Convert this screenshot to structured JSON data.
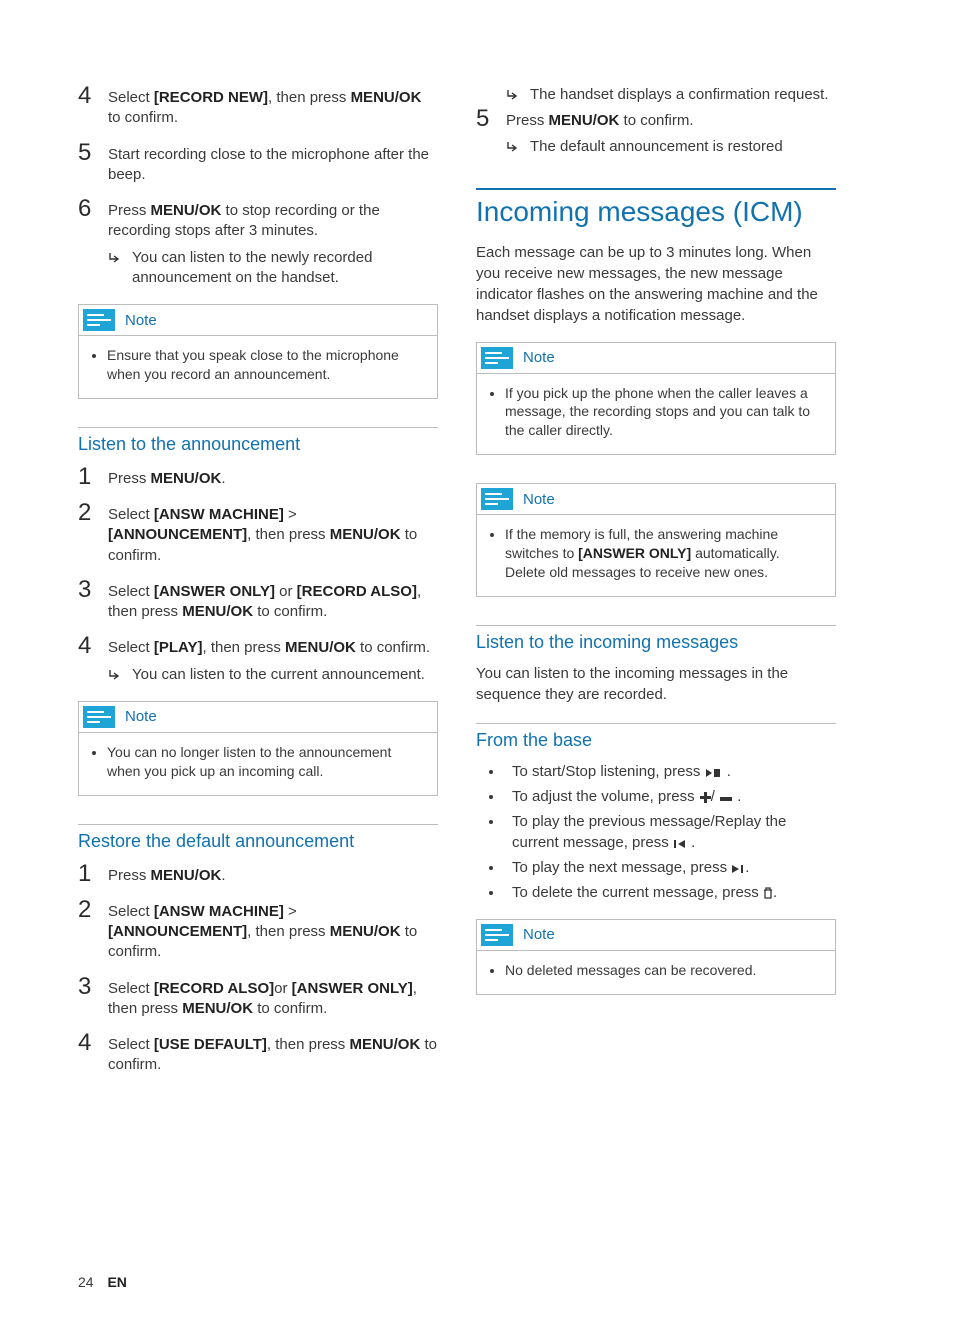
{
  "left": {
    "top_steps": {
      "s4": {
        "pre": "Select ",
        "b1": "[RECORD NEW]",
        "mid": ", then press ",
        "b2": "MENU/OK",
        "suf": " to confirm."
      },
      "s5": "Start recording close to the microphone after the beep.",
      "s6": {
        "pre": "Press ",
        "b1": "MENU/OK",
        "suf": " to stop recording or the recording stops after 3 minutes."
      },
      "s6_sub": "You can listen to the newly recorded announcement on the handset."
    },
    "note1": {
      "title": "Note",
      "text": "Ensure that you speak close to the microphone when you record an announcement."
    },
    "listen": {
      "heading": "Listen to the announcement",
      "s1": {
        "pre": "Press ",
        "b1": "MENU/OK",
        "suf": "."
      },
      "s2": {
        "pre": "Select ",
        "b1": "[ANSW MACHINE]",
        "mid": " > ",
        "b2": "[ANNOUNCEMENT]",
        "mid2": ", then press ",
        "b3": "MENU/OK",
        "suf": " to confirm."
      },
      "s3": {
        "pre": "Select ",
        "b1": "[ANSWER ONLY]",
        "mid": " or ",
        "b2": "[RECORD ALSO]",
        "mid2": ", then press ",
        "b3": "MENU/OK",
        "suf": " to confirm."
      },
      "s4": {
        "pre": "Select ",
        "b1": "[PLAY]",
        "mid": ", then press ",
        "b2": "MENU/OK",
        "suf": " to confirm."
      },
      "s4_sub": "You can listen to the current announcement."
    },
    "note2": {
      "title": "Note",
      "text": "You can no longer listen to the announcement when you pick up an incoming call."
    },
    "restore": {
      "heading": "Restore the default announcement",
      "s1": {
        "pre": "Press ",
        "b1": "MENU/OK",
        "suf": "."
      },
      "s2": {
        "pre": "Select ",
        "b1": "[ANSW MACHINE]",
        "mid": " > ",
        "b2": "[ANNOUNCEMENT]",
        "mid2": ", then press ",
        "b3": "MENU/OK",
        "suf": " to confirm."
      },
      "s3": {
        "pre": "Select ",
        "b1": "[RECORD ALSO]",
        "mid": "or ",
        "b2": "[ANSWER ONLY]",
        "mid2": ", then press ",
        "b3": "MENU/OK",
        "suf": " to confirm."
      },
      "s4": {
        "pre": "Select ",
        "b1": "[USE DEFAULT]",
        "mid": ", then press ",
        "b2": "MENU/OK",
        "suf": " to confirm."
      }
    }
  },
  "right": {
    "top": {
      "sub1": "The handset displays a confirmation request.",
      "s5": {
        "pre": "Press ",
        "b1": "MENU/OK",
        "suf": " to confirm."
      },
      "sub2": "The default announcement is restored"
    },
    "icm": {
      "heading": "Incoming messages (ICM)",
      "para": "Each message can be up to 3 minutes long. When you receive new messages, the new message indicator flashes on the answering machine and the handset displays a notification message."
    },
    "note1": {
      "title": "Note",
      "text": "If you pick up the phone when the caller leaves a message, the recording stops and you can talk to the caller directly."
    },
    "note2": {
      "title": "Note",
      "pre": "If the memory is full, the answering machine switches to ",
      "b1": "[ANSWER ONLY]",
      "suf": " automatically. Delete old messages to receive new ones."
    },
    "listen": {
      "heading": "Listen to the incoming messages",
      "para": "You can listen to the incoming messages in the sequence they are recorded."
    },
    "base": {
      "heading": "From the base",
      "b1": {
        "pre": "To start/Stop listening, press ",
        "suf": " ."
      },
      "b2": {
        "pre": "To adjust the volume, press ",
        "mid": "/",
        "suf": " ."
      },
      "b3": {
        "pre": "To play the previous message/Replay the current message, press ",
        "suf": " ."
      },
      "b4": {
        "pre": "To play the next message, press ",
        "suf": "."
      },
      "b5": {
        "pre": "To delete the current message, press ",
        "suf": "."
      }
    },
    "note3": {
      "title": "Note",
      "text": "No deleted messages can be recovered."
    }
  },
  "footer": {
    "page": "24",
    "lang": "EN"
  }
}
